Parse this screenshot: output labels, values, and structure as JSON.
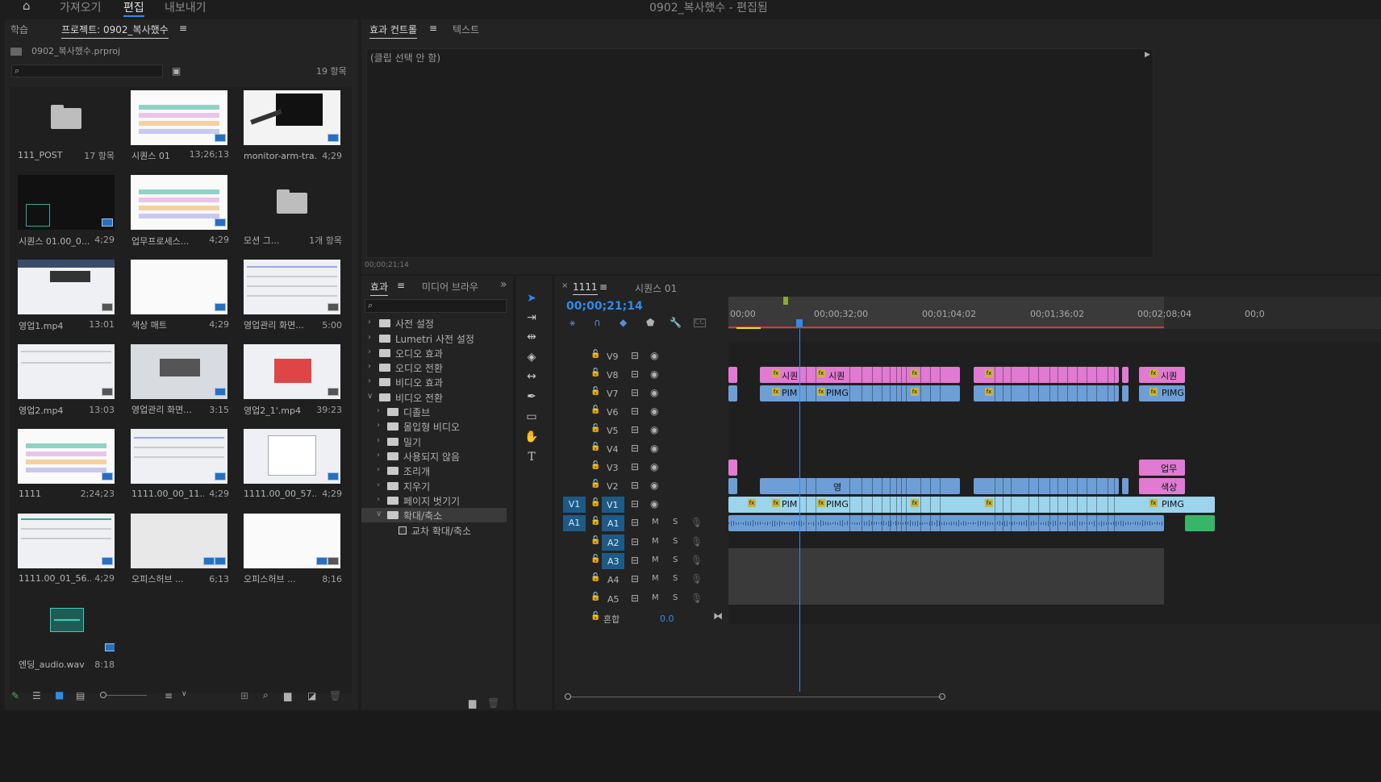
{
  "app": {
    "title": "0902_복사했수 - 편집됨"
  },
  "workspace_tabs": {
    "home_icon": "home-icon",
    "import": "가져오기",
    "edit": "편집",
    "export": "내보내기"
  },
  "project_panel": {
    "tab_learn": "학습",
    "tab_project": "프로젝트: 0902_복사했수",
    "menu_icon": "≡",
    "file_name": "0902_복사했수.prproj",
    "search_placeholder": "",
    "item_count": "19 항목",
    "items": [
      {
        "name": "111_POST",
        "duration": "17 항목",
        "kind": "folder"
      },
      {
        "name": "시퀀스 01",
        "duration": "13;26;13",
        "kind": "sequence"
      },
      {
        "name": "monitor-arm-tra...",
        "duration": "4;29",
        "kind": "image"
      },
      {
        "name": "시퀀스 01.00_0...",
        "duration": "4;29",
        "kind": "video"
      },
      {
        "name": "업무프로세스...",
        "duration": "4;29",
        "kind": "image"
      },
      {
        "name": "모션 그...",
        "duration": "1개 항목",
        "kind": "folder"
      },
      {
        "name": "영업1.mp4",
        "duration": "13:01",
        "kind": "video"
      },
      {
        "name": "색상 매트",
        "duration": "4;29",
        "kind": "matte"
      },
      {
        "name": "영업관리 화면...",
        "duration": "5:00",
        "kind": "image"
      },
      {
        "name": "영업2.mp4",
        "duration": "13:03",
        "kind": "video"
      },
      {
        "name": "영업관리 화면...",
        "duration": "3:15",
        "kind": "image"
      },
      {
        "name": "영업2_1'.mp4",
        "duration": "39:23",
        "kind": "video"
      },
      {
        "name": "1111",
        "duration": "2;24;23",
        "kind": "sequence"
      },
      {
        "name": "1111.00_00_11...",
        "duration": "4;29",
        "kind": "image"
      },
      {
        "name": "1111.00_00_57...",
        "duration": "4;29",
        "kind": "image"
      },
      {
        "name": "1111.00_01_56...",
        "duration": "4;29",
        "kind": "image"
      },
      {
        "name": "오피스허브 ...",
        "duration": "6;13",
        "kind": "image"
      },
      {
        "name": "오피스허브 ...",
        "duration": "8;16",
        "kind": "image"
      },
      {
        "name": "엔딩_audio.wav",
        "duration": "8:18",
        "kind": "audio"
      }
    ]
  },
  "effect_controls": {
    "tab_effect_controls": "효과 컨트롤",
    "tab_text": "텍스트",
    "no_clip": "(클립 선택 안 함)",
    "timecode": "00;00;21;14"
  },
  "effects_panel": {
    "tab_effects": "효과",
    "tab_media_browser": "미디어 브라우",
    "more": "»",
    "tree": [
      {
        "label": "사전 설정",
        "level": 0,
        "open": false
      },
      {
        "label": "Lumetri 사전 설정",
        "level": 0,
        "open": false
      },
      {
        "label": "오디오 효과",
        "level": 0,
        "open": false
      },
      {
        "label": "오디오 전환",
        "level": 0,
        "open": false
      },
      {
        "label": "비디오 효과",
        "level": 0,
        "open": false
      },
      {
        "label": "비디오 전환",
        "level": 0,
        "open": true
      },
      {
        "label": "디졸브",
        "level": 1,
        "open": false
      },
      {
        "label": "몰입형 비디오",
        "level": 1,
        "open": false
      },
      {
        "label": "밀기",
        "level": 1,
        "open": false
      },
      {
        "label": "사용되지 않음",
        "level": 1,
        "open": false
      },
      {
        "label": "조리개",
        "level": 1,
        "open": false
      },
      {
        "label": "지우기",
        "level": 1,
        "open": false
      },
      {
        "label": "페이지 벗기기",
        "level": 1,
        "open": false
      },
      {
        "label": "확대/축소",
        "level": 1,
        "open": true
      },
      {
        "label": "교차 확대/축소",
        "level": 2,
        "open": false
      }
    ]
  },
  "timeline": {
    "tab_1111": "1111",
    "tab_seq": "시퀀스 01",
    "timecode": "00;00;21;14",
    "ruler": [
      "00;00",
      "00;00;32;00",
      "00;01;04;02",
      "00;01;36;02",
      "00;02;08;04",
      "00;0"
    ],
    "video_tracks": [
      "V9",
      "V8",
      "V7",
      "V6",
      "V5",
      "V4",
      "V3",
      "V2",
      "V1"
    ],
    "audio_tracks": [
      "A1",
      "A2",
      "A3",
      "A4",
      "A5"
    ],
    "source_v": "V1",
    "source_a": "A1",
    "mix_label": "혼합",
    "mix_value": "0.0",
    "labels": {
      "shi": "시퀀",
      "pim": "PIM",
      "pimg": "PIMG",
      "upmu": "업무",
      "saeksang": "색상",
      "yeong": "영",
      "m": "M",
      "s": "S"
    },
    "colors": {
      "accent": "#2d8ceb",
      "playhead": "#2d8ceb",
      "pink": "#e07ad3",
      "blue": "#6d9fd6",
      "cyan": "#9cd4ed"
    }
  }
}
